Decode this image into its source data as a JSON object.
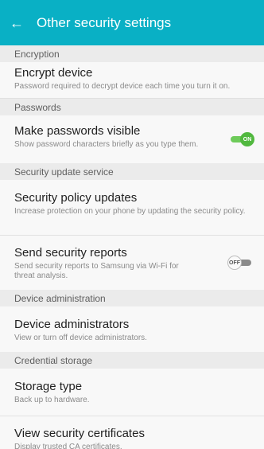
{
  "header": {
    "back_icon": "arrow-left-icon",
    "title": "Other security settings"
  },
  "colors": {
    "accent": "#09b0c5",
    "toggle_on": "#51b83f",
    "toggle_off": "#8a8a8a"
  },
  "sections": {
    "encryption": {
      "label": "Encryption",
      "encrypt_device": {
        "title": "Encrypt device",
        "subtitle": "Password required to decrypt device each time you turn it on."
      }
    },
    "passwords": {
      "label": "Passwords",
      "make_visible": {
        "title": "Make passwords visible",
        "subtitle": "Show password characters briefly as you type them.",
        "toggle_label": "ON",
        "enabled": true
      }
    },
    "security_update": {
      "label": "Security update service",
      "policy_updates": {
        "title": "Security policy updates",
        "subtitle": "Increase protection on your phone by updating the security policy."
      },
      "send_reports": {
        "title": "Send security reports",
        "subtitle": "Send security reports to Samsung via Wi-Fi for threat analysis.",
        "toggle_label": "OFF",
        "enabled": false
      }
    },
    "device_admin": {
      "label": "Device administration",
      "administrators": {
        "title": "Device administrators",
        "subtitle": "View or turn off device administrators."
      }
    },
    "credential_storage": {
      "label": "Credential storage",
      "storage_type": {
        "title": "Storage type",
        "subtitle": "Back up to hardware."
      },
      "view_certificates": {
        "title": "View security certificates",
        "subtitle": "Display trusted CA certificates."
      }
    }
  }
}
